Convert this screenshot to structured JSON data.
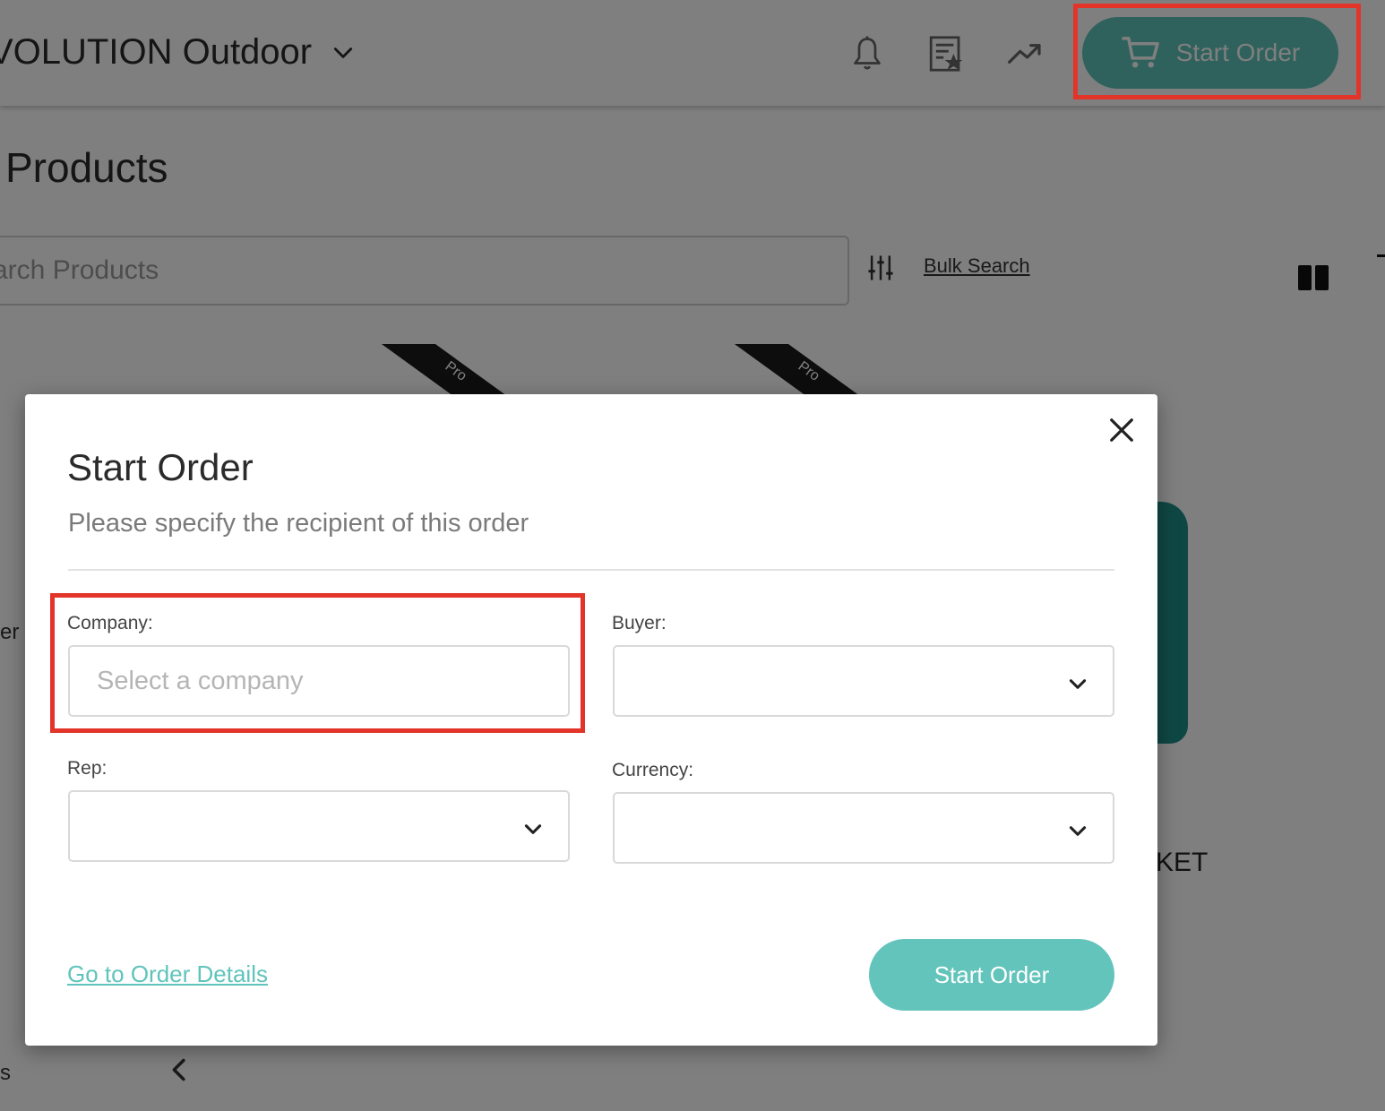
{
  "header": {
    "brand_name": "VOLUTION Outdoor",
    "start_order_label": "Start Order"
  },
  "page": {
    "title": "Products",
    "search_placeholder": "arch Products",
    "bulk_search_label": "Bulk Search",
    "ribbon_text": "Pro",
    "bg_product_fragment": "KET",
    "bg_left_fragment_1": "er",
    "bg_left_fragment_2": "s"
  },
  "modal": {
    "title": "Start Order",
    "subtitle": "Please specify the recipient of this order",
    "fields": {
      "company": {
        "label": "Company:",
        "placeholder": "Select a company",
        "value": ""
      },
      "buyer": {
        "label": "Buyer:",
        "value": ""
      },
      "rep": {
        "label": "Rep:",
        "value": ""
      },
      "currency": {
        "label": "Currency:",
        "value": ""
      }
    },
    "goto_order_details_label": "Go to Order Details",
    "start_order_label": "Start Order"
  },
  "colors": {
    "accent": "#5fc4bb",
    "highlight": "#e3342a",
    "overlay": "rgba(0,0,0,0.5)"
  }
}
